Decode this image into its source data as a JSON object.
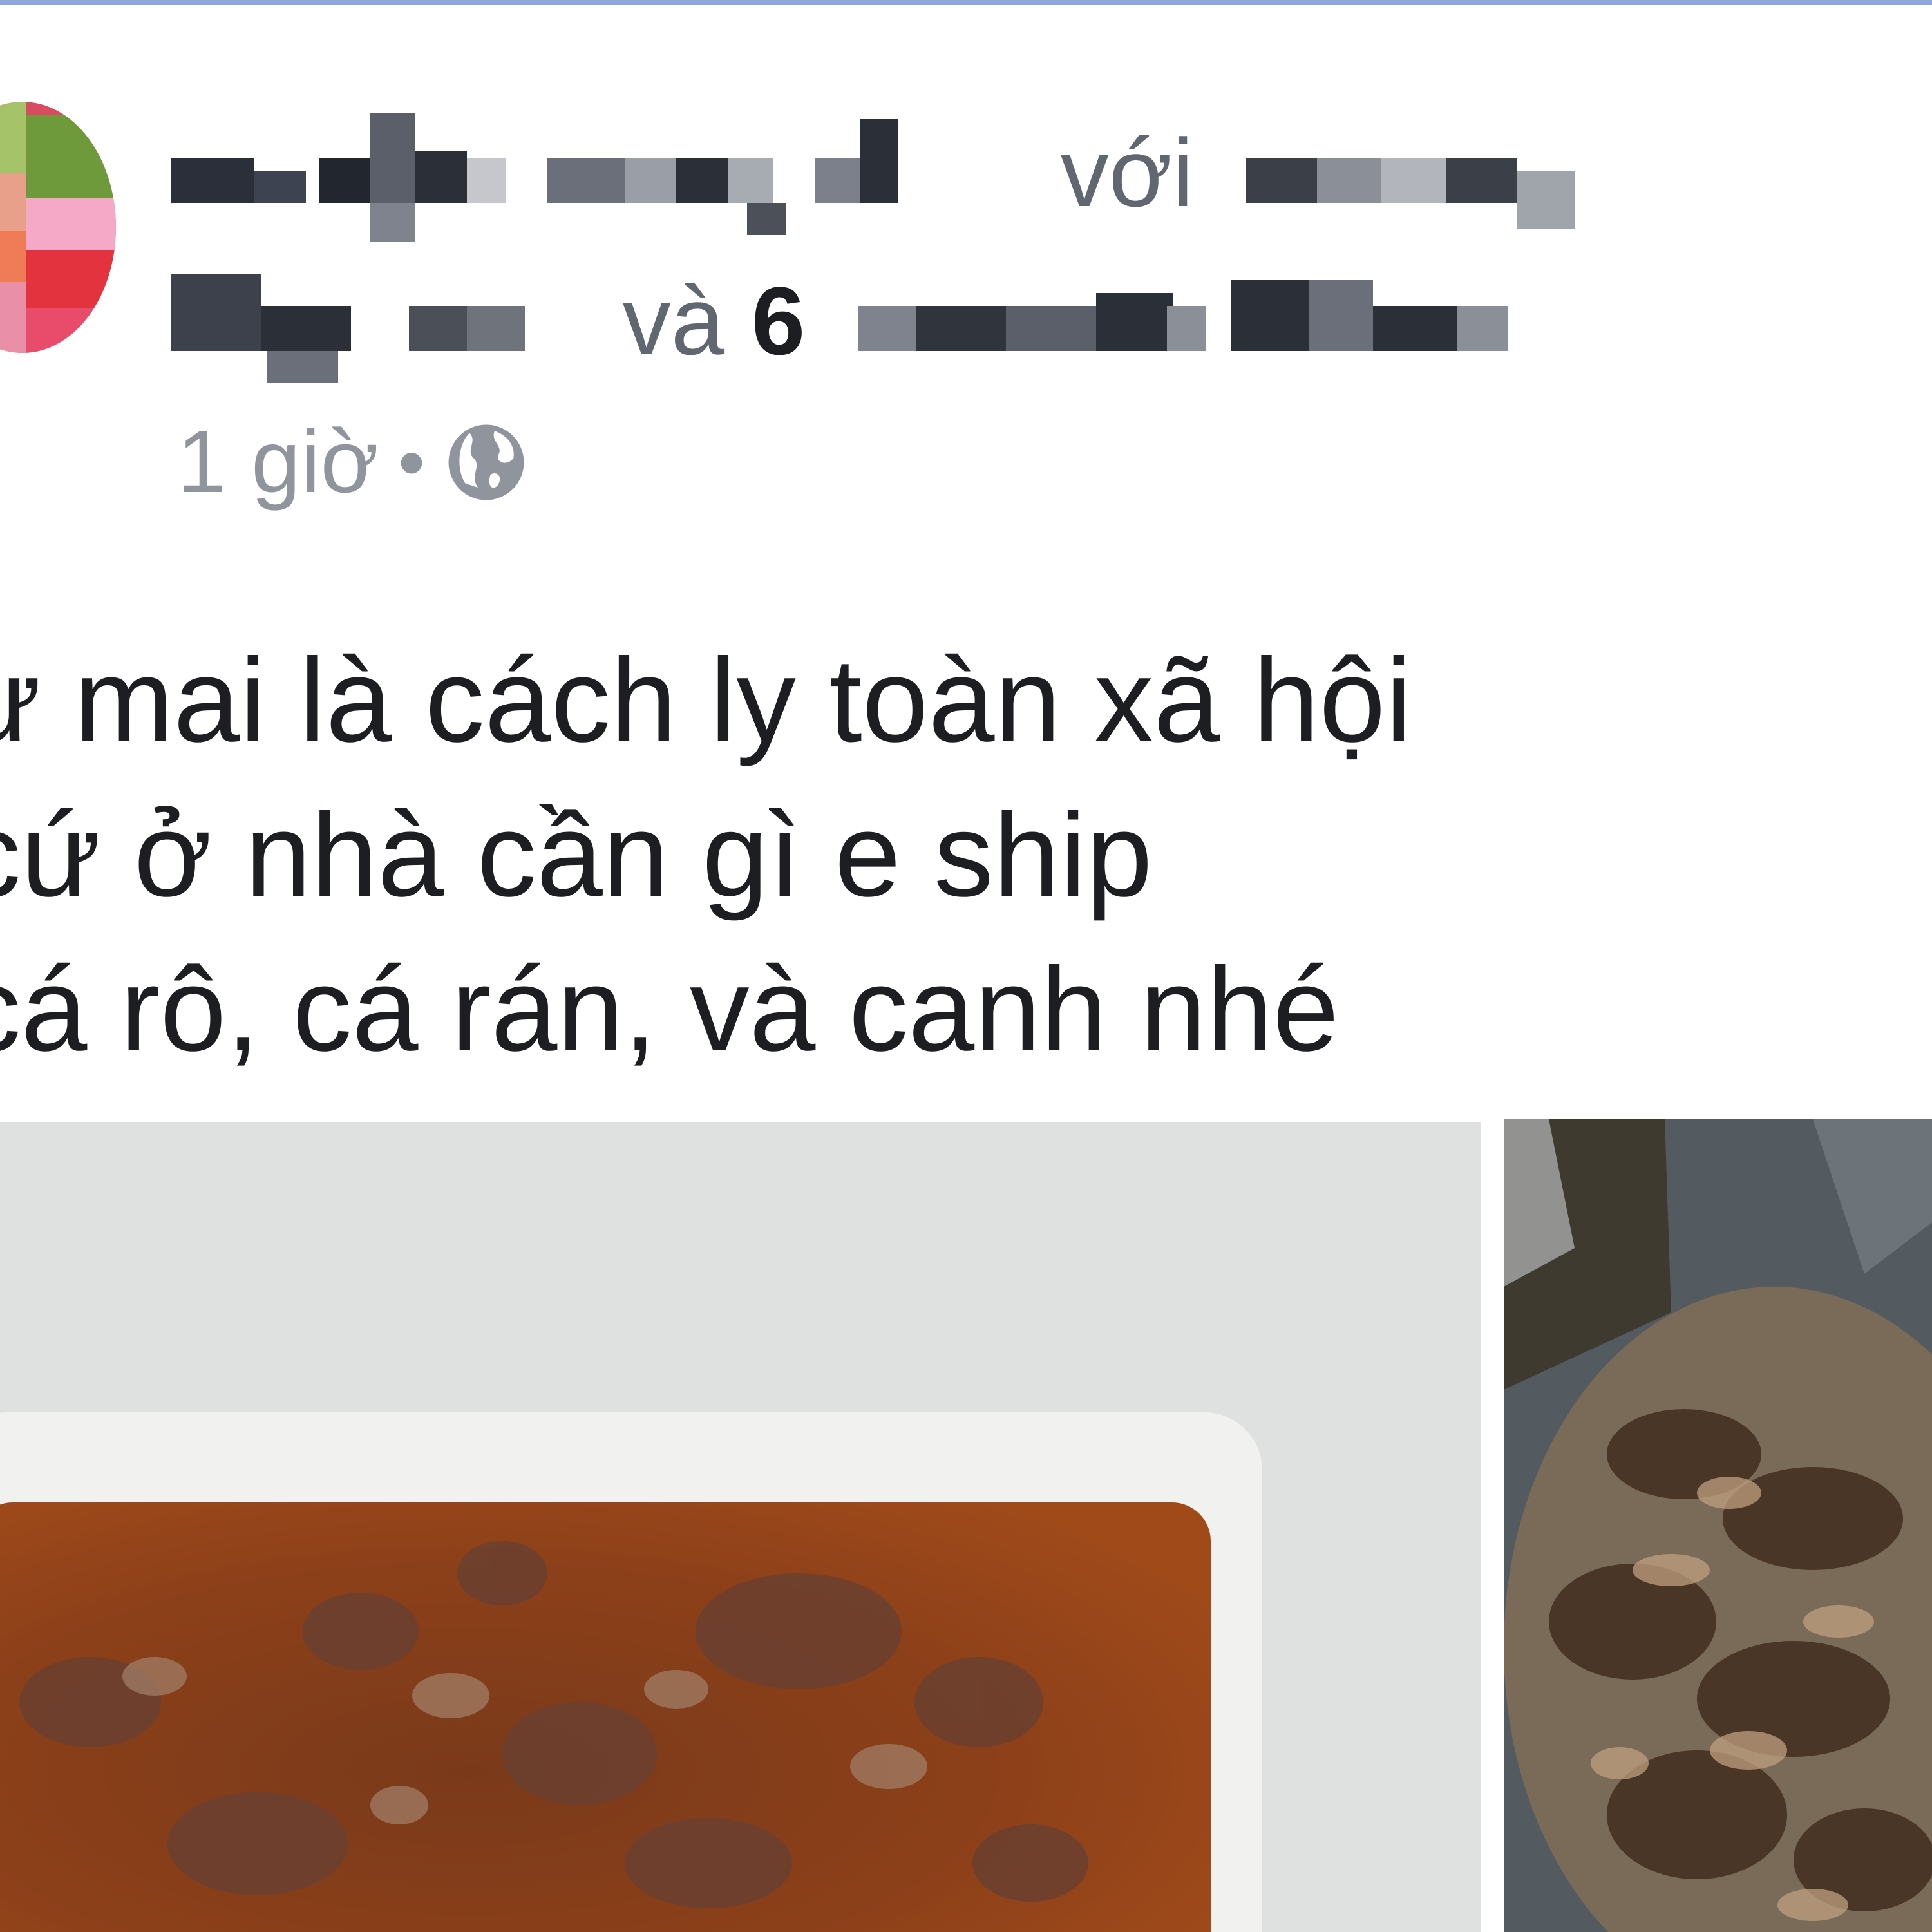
{
  "post": {
    "header": {
      "with_word": "với",
      "and_word": "và",
      "count": "6"
    },
    "timestamp": "1 giờ",
    "separator": "•",
    "privacy_icon": "globe-icon",
    "text_lines": [
      "ư mai là cách ly toàn xã hội",
      " cứ ở nhà cần gì e ship",
      "cá rô, cá rán, và canh nhé"
    ],
    "photos": [
      {
        "icon": "food-photo-sauce"
      },
      {
        "icon": "food-photo-fried-fish"
      }
    ]
  },
  "colors": {
    "text_primary": "#1c1e21",
    "text_secondary": "#606770",
    "text_meta": "#90949c",
    "top_border": "#8fa6db"
  }
}
